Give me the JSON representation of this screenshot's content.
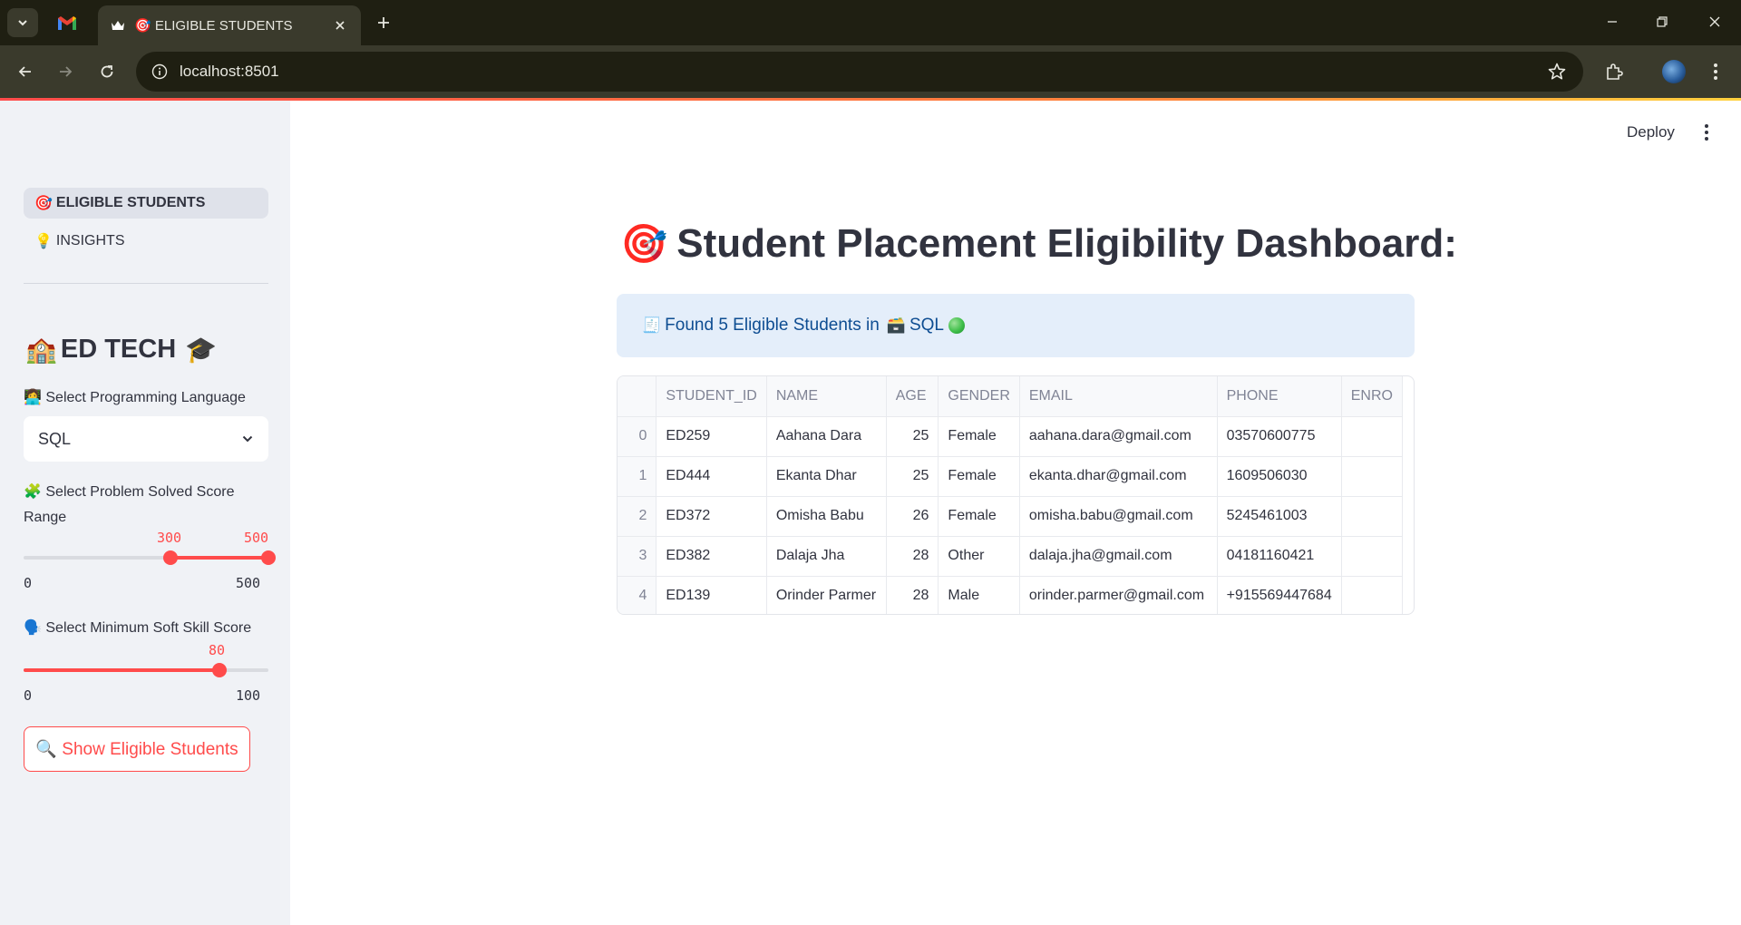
{
  "browser": {
    "tab_title": "🎯 ELIGIBLE STUDENTS",
    "url": "localhost:8501"
  },
  "sidebar": {
    "nav": [
      {
        "emoji": "🎯",
        "label": "ELIGIBLE STUDENTS",
        "active": true
      },
      {
        "emoji": "💡",
        "label": "INSIGHTS",
        "active": false
      }
    ],
    "app_title": {
      "emoji_left": "🏫",
      "text": "ED TECH",
      "emoji_right": "🎓"
    },
    "language": {
      "label": "👩‍💻 Select Programming Language",
      "value": "SQL"
    },
    "problem_score": {
      "label": "🧩 Select Problem Solved Score Range",
      "low": "300",
      "high": "500",
      "min": "0",
      "max": "500",
      "low_fraction": 0.6,
      "high_fraction": 1.0
    },
    "soft_skill": {
      "label": "🗣️ Select Minimum Soft Skill Score",
      "value": "80",
      "min": "0",
      "max": "100",
      "fraction": 0.8
    },
    "show_button": "🔍 Show Eligible Students"
  },
  "header": {
    "deploy_label": "Deploy"
  },
  "main": {
    "title_emoji": "🎯",
    "title": "Student Placement Eligibility Dashboard:",
    "info": {
      "emoji": "🧾",
      "text": "Found 5 Eligible Students in",
      "lang_emoji": "🗃️",
      "lang": "SQL"
    },
    "table": {
      "columns": [
        "",
        "STUDENT_ID",
        "NAME",
        "AGE",
        "GENDER",
        "EMAIL",
        "PHONE",
        "ENRO"
      ],
      "rows": [
        [
          "0",
          "ED259",
          "Aahana Dara",
          "25",
          "Female",
          "aahana.dara@gmail.com",
          "03570600775",
          ""
        ],
        [
          "1",
          "ED444",
          "Ekanta Dhar",
          "25",
          "Female",
          "ekanta.dhar@gmail.com",
          "1609506030",
          ""
        ],
        [
          "2",
          "ED372",
          "Omisha Babu",
          "26",
          "Female",
          "omisha.babu@gmail.com",
          "5245461003",
          ""
        ],
        [
          "3",
          "ED382",
          "Dalaja Jha",
          "28",
          "Other",
          "dalaja.jha@gmail.com",
          "04181160421",
          ""
        ],
        [
          "4",
          "ED139",
          "Orinder Parmer",
          "28",
          "Male",
          "orinder.parmer@gmail.com",
          "+915569447684",
          ""
        ]
      ]
    }
  },
  "colors": {
    "accent": "#ff4b4b",
    "sidebar_bg": "#f0f2f6",
    "info_bg": "#e4eefa",
    "info_text": "#0e4d92",
    "chrome_dark": "#1f1f12",
    "chrome_toolbar": "#3a3a2c"
  }
}
